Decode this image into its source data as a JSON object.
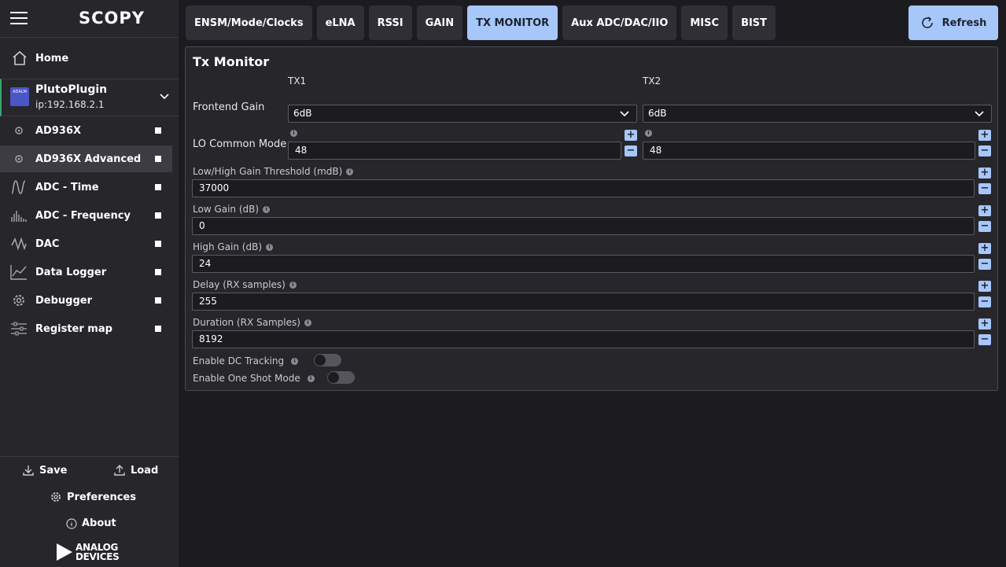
{
  "app": {
    "logo_text": "SCOPY"
  },
  "sidebar": {
    "home_label": "Home",
    "device": {
      "name": "PlutoPlugin",
      "uri": "ip:192.168.2.1",
      "icon_text": "ADALM"
    },
    "tools": [
      {
        "label": "AD936X",
        "icon": "gear-icon",
        "active": false
      },
      {
        "label": "AD936X Advanced",
        "icon": "gear-icon",
        "active": true
      },
      {
        "label": "ADC - Time",
        "icon": "time-wave-icon",
        "active": false
      },
      {
        "label": "ADC - Frequency",
        "icon": "spectrum-icon",
        "active": false
      },
      {
        "label": "DAC",
        "icon": "dac-wave-icon",
        "active": false
      },
      {
        "label": "Data Logger",
        "icon": "line-chart-icon",
        "active": false
      },
      {
        "label": "Debugger",
        "icon": "cog-icon",
        "active": false
      },
      {
        "label": "Register map",
        "icon": "sliders-icon",
        "active": false
      }
    ],
    "save_label": "Save",
    "load_label": "Load",
    "preferences_label": "Preferences",
    "about_label": "About",
    "brand_line1": "ANALOG",
    "brand_line2": "DEVICES"
  },
  "tabs": [
    {
      "label": "ENSM/Mode/Clocks",
      "active": false
    },
    {
      "label": "eLNA",
      "active": false
    },
    {
      "label": "RSSI",
      "active": false
    },
    {
      "label": "GAIN",
      "active": false
    },
    {
      "label": "TX MONITOR",
      "active": true
    },
    {
      "label": "Aux ADC/DAC/IIO",
      "active": false
    },
    {
      "label": "MISC",
      "active": false
    },
    {
      "label": "BIST",
      "active": false
    }
  ],
  "refresh_label": "Refresh",
  "panel": {
    "title": "Tx Monitor",
    "tx1_label": "TX1",
    "tx2_label": "TX2",
    "frontend_gain_label": "Frontend Gain",
    "frontend_gain_tx1": "6dB",
    "frontend_gain_tx2": "6dB",
    "lo_common_mode_label": "LO Common Mode",
    "lo_common_mode_tx1": "48",
    "lo_common_mode_tx2": "48",
    "fields": [
      {
        "label": "Low/High Gain Threshold (mdB)",
        "value": "37000"
      },
      {
        "label": "Low Gain (dB)",
        "value": "0"
      },
      {
        "label": "High Gain (dB)",
        "value": "24"
      },
      {
        "label": "Delay (RX samples)",
        "value": "255"
      },
      {
        "label": "Duration (RX Samples)",
        "value": "8192"
      }
    ],
    "dc_tracking_label": "Enable DC Tracking",
    "one_shot_label": "Enable One Shot Mode",
    "dc_tracking_on": false,
    "one_shot_on": false
  }
}
